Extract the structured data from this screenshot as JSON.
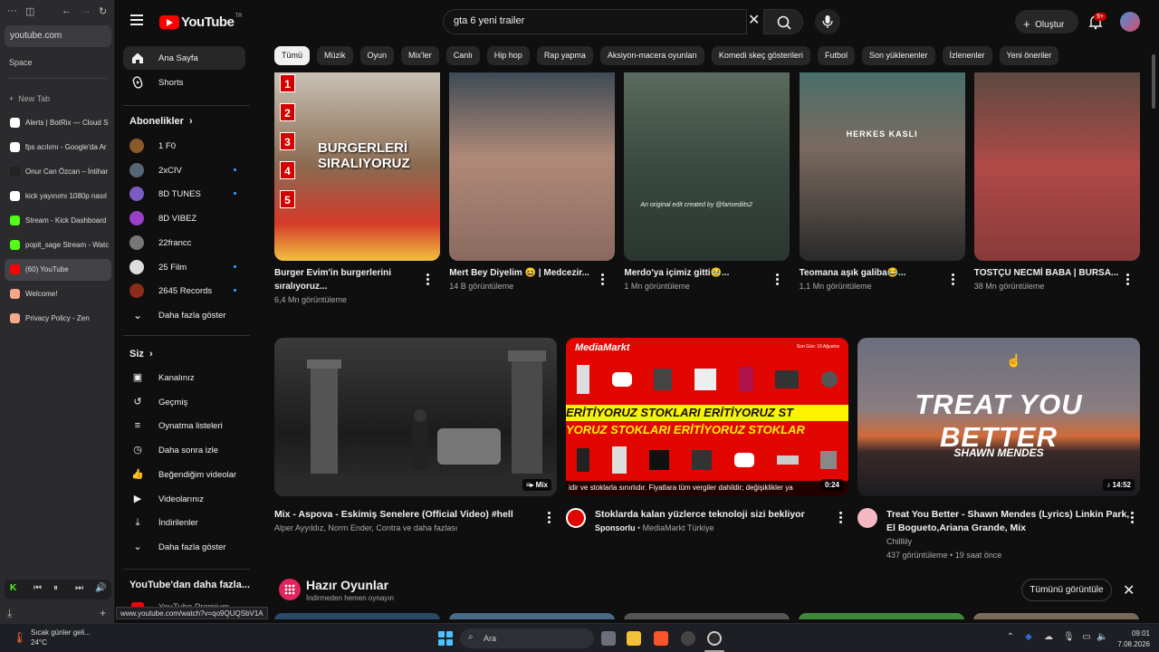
{
  "browser": {
    "url": "youtube.com",
    "space_label": "Space",
    "new_tab": "New Tab",
    "tabs": [
      {
        "label": "Alerts | BotRix — Cloud S",
        "color": "#ffffff"
      },
      {
        "label": "fps acılımı - Google'da Ar",
        "color": "#ffffff"
      },
      {
        "label": "Onur Can Özcan – İntihar",
        "color": "#222222"
      },
      {
        "label": "kick yayınımı 1080p nasıl",
        "color": "#ffffff"
      },
      {
        "label": "Stream - Kick Dashboard",
        "color": "#53fc18"
      },
      {
        "label": "popit_sage Stream - Watc",
        "color": "#53fc18"
      },
      {
        "label": "(60) YouTube",
        "color": "#ff0000"
      },
      {
        "label": "Welcome!",
        "color": "#f7a78c"
      },
      {
        "label": "Privacy Policy - Zen",
        "color": "#f7a78c"
      }
    ],
    "hover_url": "www.youtube.com/watch?v=qo9QUQSbV1A"
  },
  "topbar": {
    "logo_text": "YouTube",
    "logo_sup": "TR",
    "search_value": "gta 6 yeni trailer",
    "clear_symbol": "✕",
    "create_label": "Oluştur",
    "notif_badge": "9+"
  },
  "sidebar": {
    "home": "Ana Sayfa",
    "shorts": "Shorts",
    "subs_header": "Abonelikler",
    "channels": [
      {
        "name": "1 F0",
        "color": "#8a5a2b",
        "dot": false
      },
      {
        "name": "2xCIV",
        "color": "#556677",
        "dot": true
      },
      {
        "name": "8D TUNES",
        "color": "#7b5cc2",
        "dot": true
      },
      {
        "name": "8D VIBEZ",
        "color": "#9b3fc9",
        "dot": false
      },
      {
        "name": "22francc",
        "color": "#777777",
        "dot": false
      },
      {
        "name": "25 Film",
        "color": "#dddddd",
        "dot": true
      },
      {
        "name": "2645 Records",
        "color": "#8b2d1a",
        "dot": true
      }
    ],
    "show_more": "Daha fazla göster",
    "you_header": "Siz",
    "you_items": [
      "Kanalınız",
      "Geçmiş",
      "Oynatma listeleri",
      "Daha sonra izle",
      "Beğendiğim videolar",
      "Videolarınız",
      "İndirilenler",
      "Daha fazla göster"
    ],
    "more_header": "YouTube'dan daha fazla...",
    "premium": "YouTube Premium"
  },
  "chips": [
    "Tümü",
    "Müzik",
    "Oyun",
    "Mix'ler",
    "Canlı",
    "Hip hop",
    "Rap yapma",
    "Aksiyon-macera oyunları",
    "Komedi skeç gösterileri",
    "Futbol",
    "Son yüklenenler",
    "İzlenenler",
    "Yeni öneriler"
  ],
  "shorts": [
    {
      "title": "Burger Evim'in burgerlerini sıralıyoruz...",
      "views": "6,4 Mn görüntüleme",
      "overlay": "BURGERLERİ SIRALIYORUZ"
    },
    {
      "title": "Mert Bey Diyelim 😆 | Medcezir...",
      "views": "14 B görüntüleme",
      "overlay": ""
    },
    {
      "title": "Merdo'ya içimiz gitti🥹...",
      "views": "1 Mn görüntüleme",
      "overlay": "An original edit created by @farisediits2"
    },
    {
      "title": "Teomana aşık galiba😂...",
      "views": "1,1 Mn görüntüleme",
      "overlay": "HERKES KASLI"
    },
    {
      "title": "TOSTÇU NECMİ BABA | BURSA...",
      "views": "38 Mn görüntüleme",
      "overlay": ""
    }
  ],
  "videos": [
    {
      "title": "Mix - Aspova  - Eskimiş Senelere (Official Video) #hell",
      "sub": "Alper Ayyıldız, Norm Ender, Contra ve daha fazlası",
      "meta": "",
      "badge": "Mix"
    },
    {
      "title": "Stoklarda kalan yüzlerce teknoloji sizi bekliyor",
      "sponsor": "Sponsorlu",
      "sub": "MediaMarkt Türkiye",
      "meta": "",
      "badge": "0:24",
      "ticker": "idir ve stoklarla sınırlıdır. Fiyatlara tüm vergiler dahildir; değişiklikler ya",
      "brand": "MediaMarkt",
      "date_note": "Son Gün: 10 Ağustos",
      "banner1": "ERİTİYORUZ STOKLARI ERİTİYORUZ ST",
      "banner2": "YORUZ STOKLARI ERİTİYORUZ STOKLAR"
    },
    {
      "title": "Treat You Better - Shawn Mendes (Lyrics) Linkin Park, El Bogueto,Ariana Grande, Mix",
      "sub": "Chilllily",
      "meta": "437 görüntüleme • 19 saat önce",
      "badge": "14:52",
      "art_title": "TREAT YOU BETTER",
      "art_sub": "SHAWN MENDES"
    }
  ],
  "games": {
    "title": "Hazır Oyunlar",
    "subtitle": "İndirmeden hemen oynayın",
    "show_all": "Tümünü görüntüle"
  },
  "taskbar": {
    "weather_title": "Sıcak günler geli...",
    "weather_temp": "24°C",
    "search": "Ara",
    "time": "09:01",
    "date": "7.08.2026"
  }
}
